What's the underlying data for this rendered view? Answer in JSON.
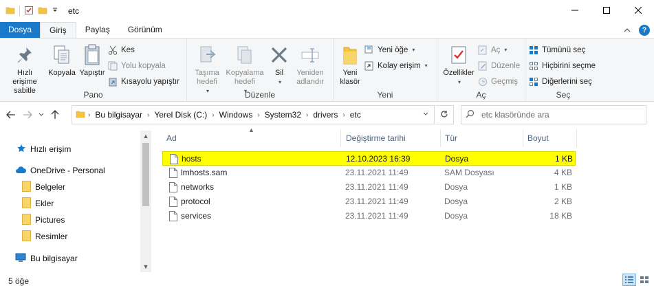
{
  "window": {
    "title": "etc"
  },
  "tabs": [
    {
      "label": "Dosya"
    },
    {
      "label": "Giriş"
    },
    {
      "label": "Paylaş"
    },
    {
      "label": "Görünüm"
    }
  ],
  "ribbon": {
    "pano": {
      "label": "Pano",
      "pin": "Hızlı erişime sabitle",
      "copy": "Kopyala",
      "paste": "Yapıştır",
      "cut": "Kes",
      "copy_path": "Yolu kopyala",
      "paste_shortcut": "Kısayolu yapıştır"
    },
    "duzenle": {
      "label": "Düzenle",
      "move_to": "Taşıma hedefi",
      "copy_to": "Kopyalama hedefi",
      "delete": "Sil",
      "rename": "Yeniden adlandır"
    },
    "yeni": {
      "label": "Yeni",
      "new_folder": "Yeni klasör",
      "new_item": "Yeni öğe",
      "easy_access": "Kolay erişim"
    },
    "ac": {
      "label": "Aç",
      "properties": "Özellikler",
      "open": "Aç",
      "edit": "Düzenle",
      "history": "Geçmiş"
    },
    "sec": {
      "label": "Seç",
      "select_all": "Tümünü seç",
      "select_none": "Hiçbirini seçme",
      "invert": "Diğerlerini seç"
    }
  },
  "address": {
    "crumbs": [
      "Bu bilgisayar",
      "Yerel Disk (C:)",
      "Windows",
      "System32",
      "drivers",
      "etc"
    ],
    "search_placeholder": "etc klasöründe ara"
  },
  "nav": {
    "quick_access": "Hızlı erişim",
    "onedrive": "OneDrive - Personal",
    "folders": [
      "Belgeler",
      "Ekler",
      "Pictures",
      "Resimler"
    ],
    "this_pc": "Bu bilgisayar"
  },
  "columns": {
    "name": "Ad",
    "date": "Değiştirme tarihi",
    "type": "Tür",
    "size": "Boyut"
  },
  "files": [
    {
      "name": "hosts",
      "date": "12.10.2023 16:39",
      "type": "Dosya",
      "size": "1 KB"
    },
    {
      "name": "lmhosts.sam",
      "date": "23.11.2021 11:49",
      "type": "SAM Dosyası",
      "size": "4 KB"
    },
    {
      "name": "networks",
      "date": "23.11.2021 11:49",
      "type": "Dosya",
      "size": "1 KB"
    },
    {
      "name": "protocol",
      "date": "23.11.2021 11:49",
      "type": "Dosya",
      "size": "2 KB"
    },
    {
      "name": "services",
      "date": "23.11.2021 11:49",
      "type": "Dosya",
      "size": "18 KB"
    }
  ],
  "status": {
    "count": "5 öğe"
  },
  "colors": {
    "accent": "#1979ca",
    "highlight": "#ffff00",
    "folder": "#f4c542"
  }
}
